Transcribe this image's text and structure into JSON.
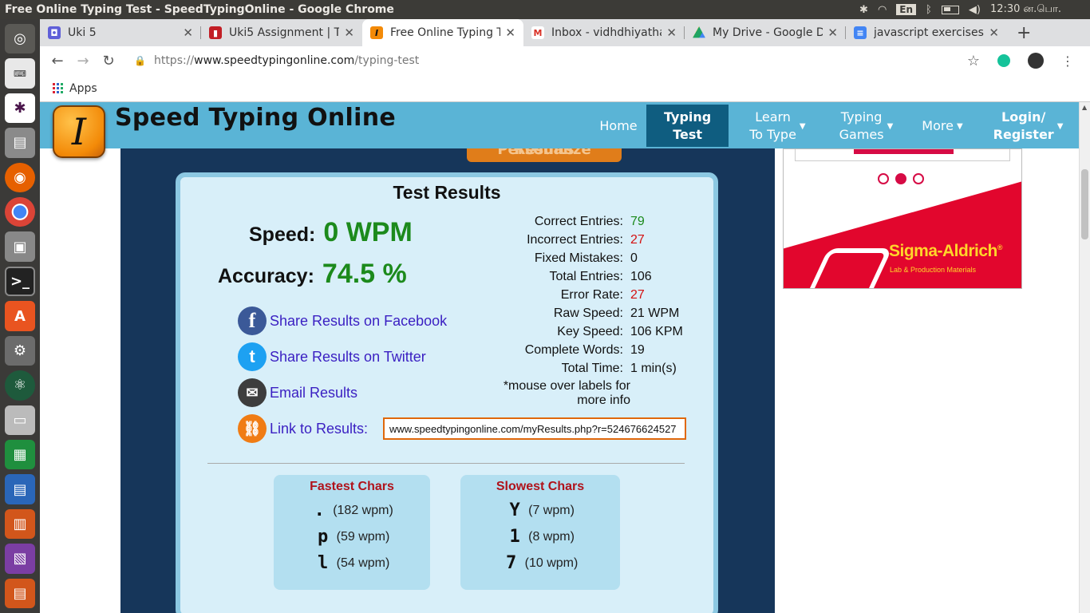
{
  "window": {
    "title": "Free Online Typing Test - SpeedTypingOnline - Google Chrome"
  },
  "system_tray": {
    "language": "En",
    "clock": "12:30 ன.பொ."
  },
  "tabs": [
    {
      "label": "Uki 5",
      "favicon_color": "#5f5fd8",
      "favicon": "person-icon"
    },
    {
      "label": "Uki5 Assignment | Tr",
      "favicon_color": "#c21e25",
      "favicon": "trello-icon"
    },
    {
      "label": "Free Online Typing T",
      "favicon_color": "#f38a08",
      "favicon": "speedtyping-icon"
    },
    {
      "label": "Inbox - vidhdhiyatha",
      "favicon_color": "#d93025",
      "favicon": "gmail-icon"
    },
    {
      "label": "My Drive - Google Dr",
      "favicon_color": "#1fa463",
      "favicon": "drive-icon"
    },
    {
      "label": "javascript exercises",
      "favicon_color": "#4285f4",
      "favicon": "docs-icon"
    }
  ],
  "address": {
    "scheme": "https://",
    "host": "www.speedtypingonline.com",
    "path": "/typing-test"
  },
  "bookmarks": {
    "apps_label": "Apps"
  },
  "site": {
    "name": "Speed Typing Online",
    "logo_letter": "I",
    "nav": {
      "home": "Home",
      "typing_test_1": "Typing",
      "typing_test_2": "Test",
      "learn_1": "Learn",
      "learn_2": "To Type",
      "games_1": "Typing",
      "games_2": "Games",
      "more": "More",
      "login_1": "Login/",
      "login_2": "Register"
    }
  },
  "personalize_button": "Personalize Results",
  "results": {
    "title": "Test Results",
    "speed_label": "Speed:",
    "speed_value": "0 WPM",
    "accuracy_label": "Accuracy:",
    "accuracy_value": "74.5 %",
    "share": {
      "facebook": "Share Results on Facebook",
      "twitter": "Share Results on Twitter",
      "email": "Email Results",
      "link": "Link to Results:"
    },
    "link_value": "www.speedtypingonline.com/myResults.php?r=524676624527",
    "stats": [
      {
        "label": "Correct Entries:",
        "value": "79",
        "color": "green"
      },
      {
        "label": "Incorrect Entries:",
        "value": "27",
        "color": "red"
      },
      {
        "label": "Fixed Mistakes:",
        "value": "0",
        "color": ""
      },
      {
        "label": "Total Entries:",
        "value": "106",
        "color": ""
      },
      {
        "label": "Error Rate:",
        "value": "27",
        "color": "red"
      },
      {
        "label": "Raw Speed:",
        "value": "21 WPM",
        "color": ""
      },
      {
        "label": "Key Speed:",
        "value": "106 KPM",
        "color": ""
      },
      {
        "label": "Complete Words:",
        "value": "19",
        "color": ""
      },
      {
        "label": "Total Time:",
        "value": "1 min(s)",
        "color": ""
      }
    ],
    "note_1": "*mouse over labels for",
    "note_2": "more info",
    "fastest": {
      "title": "Fastest Chars",
      "items": [
        {
          "char": ".",
          "speed": "(182 wpm)"
        },
        {
          "char": "p",
          "speed": "(59 wpm)"
        },
        {
          "char": "l",
          "speed": "(54 wpm)"
        }
      ]
    },
    "slowest": {
      "title": "Slowest Chars",
      "items": [
        {
          "char": "Y",
          "speed": "(7 wpm)"
        },
        {
          "char": "1",
          "speed": "(8 wpm)"
        },
        {
          "char": "7",
          "speed": "(10 wpm)"
        }
      ]
    }
  },
  "ad": {
    "brand": "Sigma-Aldrich",
    "brand_mark": "®",
    "tagline": "Lab & Production Materials"
  },
  "colors": {
    "header": "#5ab4d6",
    "nav_active": "#0f5d80",
    "content_bg": "#16365a",
    "result_bg": "#d8eff9",
    "good": "#1c8a1c",
    "bad": "#d41111"
  }
}
